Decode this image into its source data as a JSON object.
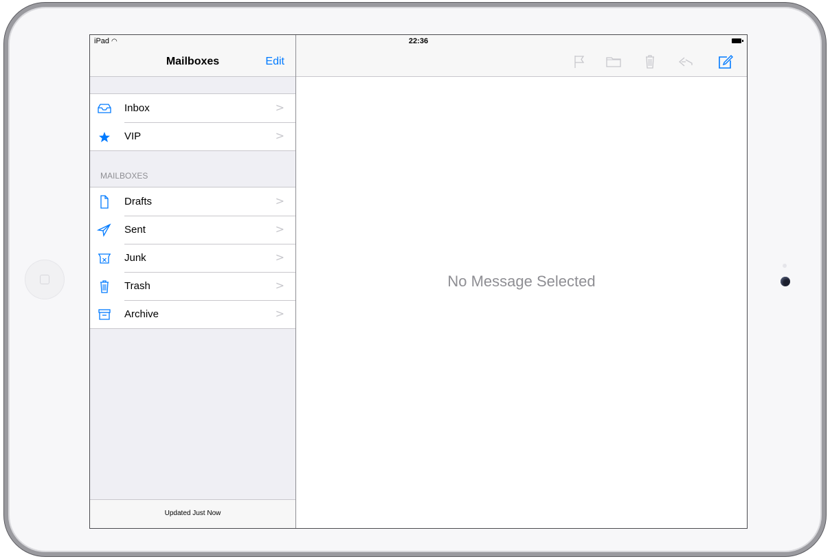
{
  "status_bar": {
    "device": "iPad",
    "time": "22:36"
  },
  "sidebar": {
    "title": "Mailboxes",
    "edit_label": "Edit",
    "top_items": [
      {
        "label": "Inbox",
        "icon": "inbox-icon"
      },
      {
        "label": "VIP",
        "icon": "star-icon"
      }
    ],
    "section_header": "MAILBOXES",
    "mailboxes": [
      {
        "label": "Drafts",
        "icon": "document-icon"
      },
      {
        "label": "Sent",
        "icon": "paper-plane-icon"
      },
      {
        "label": "Junk",
        "icon": "junk-icon"
      },
      {
        "label": "Trash",
        "icon": "trash-icon"
      },
      {
        "label": "Archive",
        "icon": "archive-icon"
      }
    ],
    "footer": "Updated Just Now",
    "chevron": ">"
  },
  "detail": {
    "empty_message": "No Message Selected",
    "toolbar_icons": [
      "flag-icon",
      "folder-icon",
      "trash-icon",
      "reply-icon",
      "compose-icon"
    ]
  },
  "colors": {
    "accent": "#007aff",
    "disabled_icon": "#c7c7cc",
    "background": "#efeff4"
  }
}
